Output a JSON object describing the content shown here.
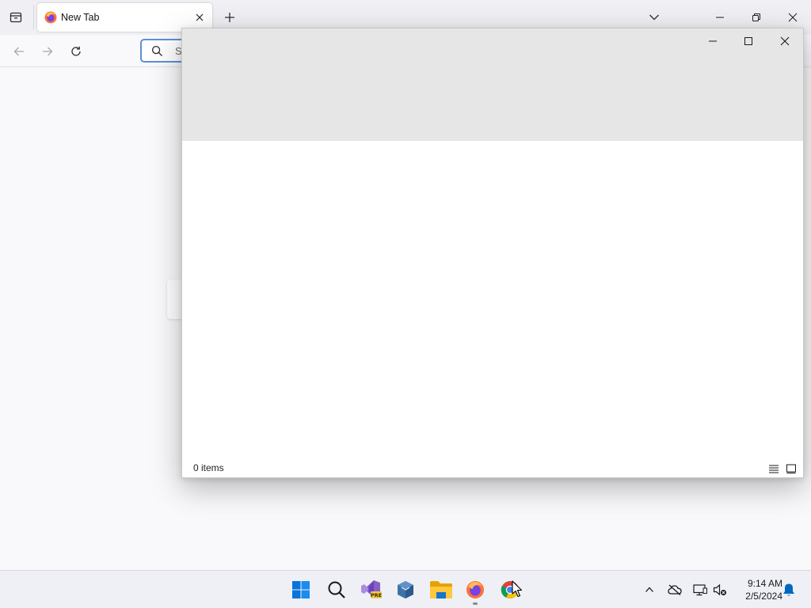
{
  "browser": {
    "tab": {
      "title": "New Tab"
    },
    "urlbar": {
      "value": "S"
    }
  },
  "dialog": {
    "status": {
      "item_count": "0 items"
    }
  },
  "taskbar": {
    "apps": [
      "start-icon",
      "search-icon",
      "visual-studio-icon",
      "virtualbox-icon",
      "file-explorer-icon",
      "firefox-icon",
      "chrome-icon"
    ],
    "clock": {
      "time": "9:14 AM",
      "date": "2/5/2024"
    }
  },
  "colors": {
    "urlbar_focus": "#5d8fd8",
    "dialog_header": "#e6e6e6",
    "taskbar": "#eef0f5",
    "windows_blue": "#0078d4"
  }
}
